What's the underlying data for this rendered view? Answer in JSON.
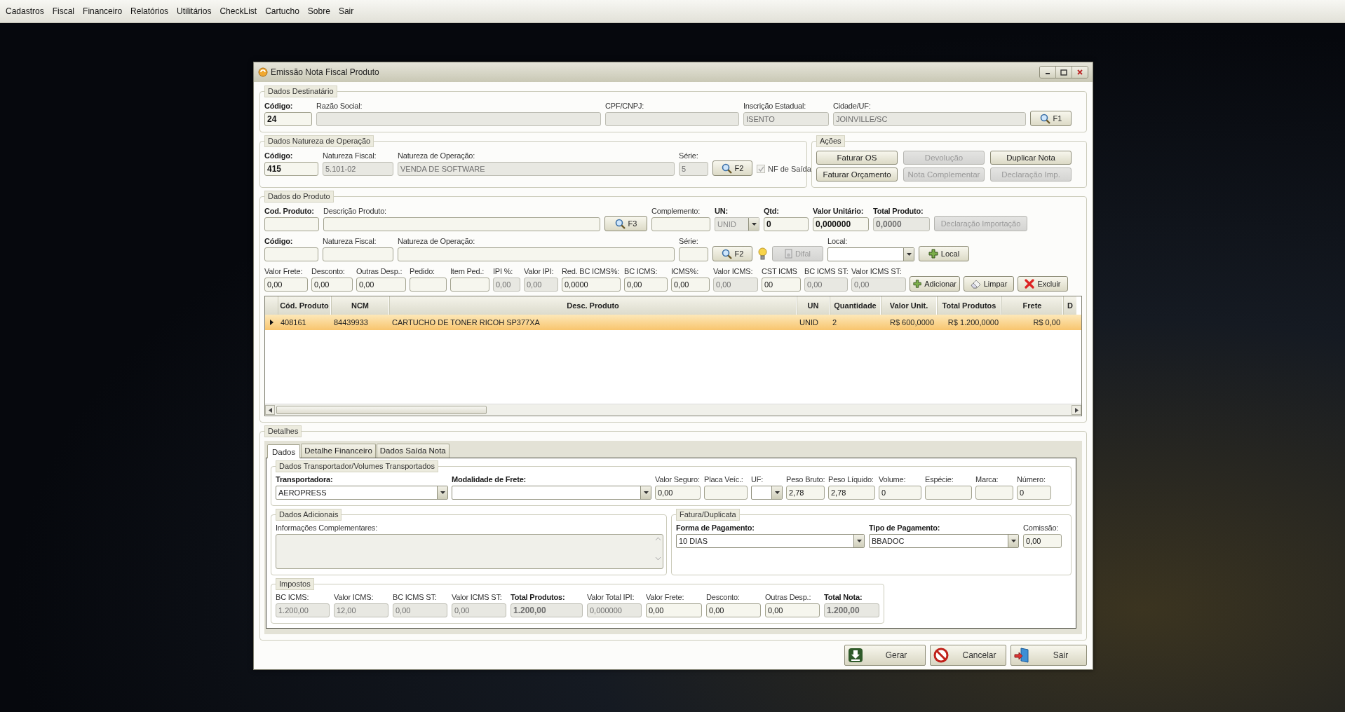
{
  "menu": [
    "Cadastros",
    "Fiscal",
    "Financeiro",
    "Relatórios",
    "Utilitários",
    "CheckList",
    "Cartucho",
    "Sobre",
    "Sair"
  ],
  "window": {
    "title": "Emissão Nota Fiscal Produto"
  },
  "destinatario": {
    "title": "Dados Destinatário",
    "fields": [
      {
        "kind": "text",
        "label": "Código:",
        "bold": true,
        "value": "24",
        "disabled": false
      },
      {
        "kind": "text",
        "label": "Razão Social:",
        "disabled": true
      },
      {
        "kind": "text",
        "label": "CPF/CNPJ:",
        "disabled": true
      },
      {
        "kind": "text",
        "label": "Inscrição Estadual:",
        "value": "ISENTO",
        "disabled": true
      },
      {
        "kind": "text",
        "label": "Cidade/UF:",
        "value": "JOINVILLE/SC",
        "disabled": true
      },
      {
        "kind": "search",
        "text": "F1",
        "disabled": false
      }
    ]
  },
  "natureza": {
    "title": "Dados Natureza de Operação",
    "fields": [
      {
        "kind": "text",
        "label": "Código:",
        "bold": true,
        "value": "415",
        "disabled": false
      },
      {
        "kind": "text",
        "label": "Natureza Fiscal:",
        "value": "5.101-02",
        "disabled": true
      },
      {
        "kind": "text",
        "label": "Natureza de Operação:",
        "value": "VENDA DE SOFTWARE",
        "disabled": true
      },
      {
        "kind": "text",
        "label": "Série:",
        "value": "5",
        "disabled": true
      },
      {
        "kind": "search",
        "text": "F2",
        "disabled": false
      },
      {
        "kind": "check",
        "text": "NF de Saída",
        "checked": true,
        "disabled": true
      }
    ]
  },
  "acoes": {
    "title": "Ações",
    "buttons": [
      {
        "label": "Faturar OS",
        "disabled": false
      },
      {
        "label": "Devolução",
        "disabled": true
      },
      {
        "label": "Duplicar Nota",
        "disabled": false
      },
      {
        "label": "Faturar Orçamento",
        "disabled": false
      },
      {
        "label": "Nota Complementar",
        "disabled": true
      },
      {
        "label": "Declaração Imp.",
        "disabled": true
      }
    ]
  },
  "produto": {
    "title": "Dados do Produto",
    "line_1": {
      "fields": [
        {
          "kind": "text",
          "label": "Cod. Produto:",
          "bold": true,
          "disabled": false
        },
        {
          "kind": "text",
          "label": "Descrição Produto:",
          "disabled": false
        },
        {
          "kind": "search",
          "text": "F3",
          "disabled": false
        },
        {
          "kind": "text",
          "label": "Complemento:",
          "disabled": false
        },
        {
          "kind": "combo",
          "label": "UN:",
          "bold": true,
          "value": "UNID",
          "disabled": true
        },
        {
          "kind": "text",
          "label": "Qtd:",
          "bold": true,
          "value": "0",
          "disabled": false
        },
        {
          "kind": "text",
          "label": "Valor Unitário:",
          "bold": true,
          "value": "0,000000",
          "disabled": false
        },
        {
          "kind": "text",
          "label": "Total Produto:",
          "bold": true,
          "value": "0,0000",
          "disabled": true
        },
        {
          "kind": "plain",
          "text": "Declaração Importação",
          "disabled": true
        }
      ]
    },
    "line_2": {
      "fields": [
        {
          "kind": "text",
          "label": "Código:",
          "bold": true,
          "disabled": false
        },
        {
          "kind": "text",
          "label": "Natureza Fiscal:",
          "disabled": false
        },
        {
          "kind": "text",
          "label": "Natureza de Operação:",
          "disabled": false
        },
        {
          "kind": "text",
          "label": "Série:",
          "disabled": false
        },
        {
          "kind": "search",
          "text": "F2",
          "disabled": false
        },
        {
          "kind": "bulb"
        },
        {
          "kind": "difal",
          "text": "Difal",
          "disabled": true
        },
        {
          "kind": "combo",
          "label": "Local:",
          "disabled": false
        },
        {
          "kind": "add",
          "text": "Local",
          "disabled": false
        }
      ]
    },
    "line_3": {
      "fields": [
        {
          "kind": "text",
          "label": "Valor Frete:",
          "value": "0,00",
          "disabled": false
        },
        {
          "kind": "text",
          "label": "Desconto:",
          "value": "0,00",
          "disabled": false
        },
        {
          "kind": "text",
          "label": "Outras Desp.:",
          "value": "0,00",
          "disabled": false
        },
        {
          "kind": "text",
          "label": "Pedido:",
          "disabled": false
        },
        {
          "kind": "text",
          "label": "Item Ped.:",
          "disabled": false
        },
        {
          "kind": "text",
          "label": "IPI %:",
          "value": "0,00",
          "disabled": true
        },
        {
          "kind": "text",
          "label": "Valor IPI:",
          "value": "0,00",
          "disabled": true
        },
        {
          "kind": "text",
          "label": "Red. BC ICMS%:",
          "value": "0,0000",
          "disabled": false
        },
        {
          "kind": "text",
          "label": "BC ICMS:",
          "value": "0,00",
          "disabled": false
        },
        {
          "kind": "text",
          "label": "ICMS%:",
          "value": "0,00",
          "disabled": false
        },
        {
          "kind": "text",
          "label": "Valor ICMS:",
          "value": "0,00",
          "disabled": true
        },
        {
          "kind": "text",
          "label": "CST ICMS",
          "value": "00",
          "disabled": false
        },
        {
          "kind": "text",
          "label": "BC ICMS ST:",
          "value": "0,00",
          "disabled": true
        },
        {
          "kind": "text",
          "label": "Valor ICMS ST:",
          "value": "0,00",
          "disabled": true
        },
        {
          "kind": "add",
          "text": "Adicionar",
          "disabled": false
        },
        {
          "kind": "clear",
          "text": "Limpar",
          "disabled": false
        },
        {
          "kind": "delete",
          "text": "Excluir",
          "disabled": false
        }
      ]
    },
    "table": {
      "columns": [
        "Cód. Produto",
        "NCM",
        "Desc. Produto",
        "UN",
        "Quantidade",
        "Valor Unit.",
        "Total Produtos",
        "Frete",
        "D"
      ],
      "rows": [
        {
          "selected": true,
          "cells": [
            "408161",
            "84439933",
            "CARTUCHO DE TONER RICOH SP377XA",
            "UNID",
            "2",
            "R$ 600,0000",
            "R$ 1.200,0000",
            "R$ 0,00"
          ]
        }
      ]
    }
  },
  "detalhes": {
    "title": "Detalhes",
    "tabs": [
      {
        "label": "Dados",
        "selected": true
      },
      {
        "label": "Detalhe Financeiro",
        "selected": false
      },
      {
        "label": "Dados Saída Nota",
        "selected": false
      }
    ],
    "transportador": {
      "title": "Dados Transportador/Volumes Transportados",
      "fields": [
        {
          "kind": "combo",
          "label": "Transportadora:",
          "bold": true,
          "value": "AEROPRESS",
          "disabled": false
        },
        {
          "kind": "combo",
          "label": "Modalidade de Frete:",
          "bold": true,
          "disabled": false
        },
        {
          "kind": "text",
          "label": "Valor Seguro:",
          "value": "0,00",
          "disabled": false
        },
        {
          "kind": "text",
          "label": "Placa Veíc.:",
          "disabled": false
        },
        {
          "kind": "combo",
          "label": "UF:",
          "disabled": false
        },
        {
          "kind": "text",
          "label": "Peso Bruto:",
          "value": "2,78",
          "disabled": false
        },
        {
          "kind": "text",
          "label": "Peso Líquido:",
          "value": "2,78",
          "disabled": false
        },
        {
          "kind": "text",
          "label": "Volume:",
          "value": "0",
          "disabled": false
        },
        {
          "kind": "text",
          "label": "Espécie:",
          "disabled": false
        },
        {
          "kind": "text",
          "label": "Marca:",
          "disabled": false
        },
        {
          "kind": "text",
          "label": "Número:",
          "value": "0",
          "disabled": false
        }
      ]
    },
    "adicionais": {
      "title": "Dados Adicionais",
      "label": "Informações Complementares:",
      "disabled": true
    },
    "fatura": {
      "title": "Fatura/Duplicata",
      "fields": [
        {
          "kind": "combo",
          "label": "Forma de Pagamento:",
          "bold": true,
          "value": "10 DIAS",
          "disabled": false
        },
        {
          "kind": "combo",
          "label": "Tipo de Pagamento:",
          "bold": true,
          "value": "BBADOC",
          "disabled": false
        },
        {
          "kind": "text",
          "label": "Comissão:",
          "value": "0,00",
          "disabled": false
        }
      ]
    },
    "impostos": {
      "title": "Impostos",
      "fields": [
        {
          "kind": "text",
          "label": "BC ICMS:",
          "value": "1.200,00",
          "disabled": true
        },
        {
          "kind": "text",
          "label": "Valor ICMS:",
          "value": "12,00",
          "disabled": true
        },
        {
          "kind": "text",
          "label": "BC ICMS ST:",
          "value": "0,00",
          "disabled": true
        },
        {
          "kind": "text",
          "label": "Valor ICMS ST:",
          "value": "0,00",
          "disabled": true
        },
        {
          "kind": "text",
          "label": "Total Produtos:",
          "bold": true,
          "value": "1.200,00",
          "disabled": true
        },
        {
          "kind": "text",
          "label": "Valor Total IPI:",
          "value": "0,000000",
          "disabled": true
        },
        {
          "kind": "text",
          "label": "Valor Frete:",
          "value": "0,00",
          "disabled": false
        },
        {
          "kind": "text",
          "label": "Desconto:",
          "value": "0,00",
          "disabled": false
        },
        {
          "kind": "text",
          "label": "Outras Desp.:",
          "value": "0,00",
          "disabled": false
        },
        {
          "kind": "text",
          "label": "Total Nota:",
          "bold": true,
          "value": "1.200,00",
          "disabled": true
        }
      ]
    }
  },
  "footer_buttons": [
    {
      "kind": "generate",
      "label": "Gerar"
    },
    {
      "kind": "cancel",
      "label": "Cancelar"
    },
    {
      "kind": "exit",
      "label": "Sair"
    }
  ]
}
